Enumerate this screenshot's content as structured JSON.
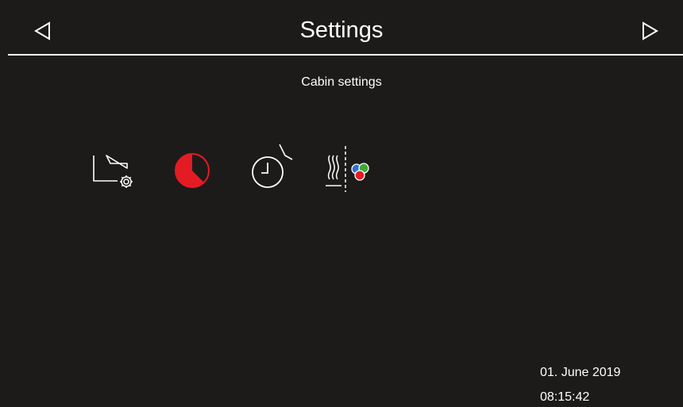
{
  "header": {
    "title": "Settings",
    "prev_icon": "triangle-left-icon",
    "next_icon": "triangle-right-icon"
  },
  "subtitle": "Cabin settings",
  "icons": [
    {
      "name": "folder-settings-icon",
      "selected": false
    },
    {
      "name": "pie-timer-icon",
      "selected": true
    },
    {
      "name": "clock-door-icon",
      "selected": false
    },
    {
      "name": "heat-color-light-icon",
      "selected": false
    }
  ],
  "footer": {
    "date": "01. June 2019",
    "time": "08:15:42"
  },
  "colors": {
    "background": "#1d1b1a",
    "foreground": "#ffffff",
    "accent": "#e31c23",
    "light_blue": "#2f6fd1",
    "light_green": "#3ba935",
    "light_red": "#e31c23"
  }
}
